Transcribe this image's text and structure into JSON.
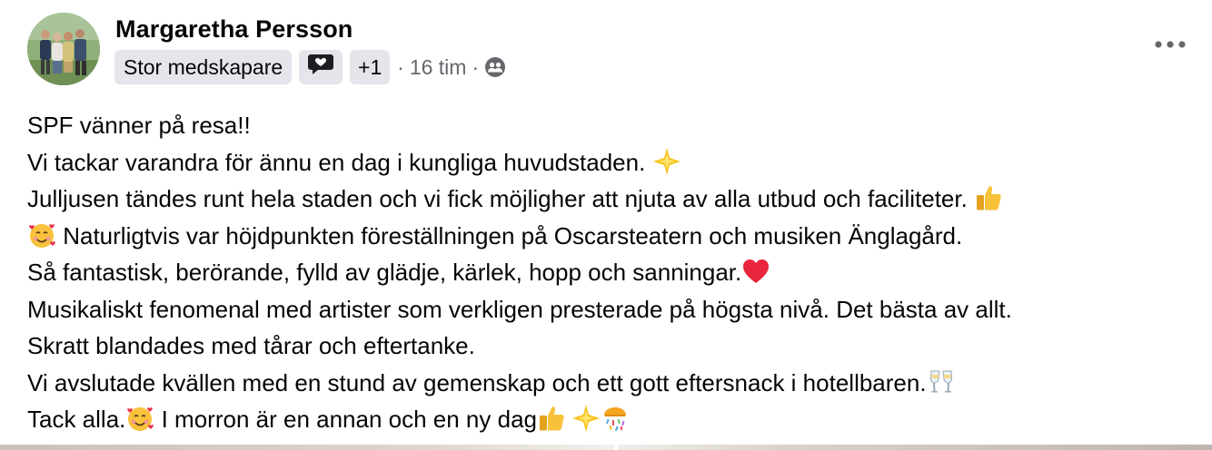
{
  "post": {
    "author_name": "Margaretha Persson",
    "badge_label": "Stor medskapare",
    "badge_icon": "speech-bubble-heart-icon",
    "badge_more": "+1",
    "meta_separator": "·",
    "time": "16 tim",
    "audience_icon": "friends-icon",
    "more_icon": "more-options-icon",
    "lines": [
      {
        "text": "SPF vänner på resa!!"
      },
      {
        "text": "Vi tackar varandra för ännu en dag i kungliga huvudstaden. ",
        "emoji_after": [
          "sparkle-star"
        ]
      },
      {
        "text": "Julljusen tändes runt hela staden och vi fick möjligher att njuta av alla utbud och faciliteter. ",
        "emoji_after": [
          "thumbs-up"
        ]
      },
      {
        "emoji_before": [
          "smiling-face-with-hearts"
        ],
        "text": " Naturligtvis var höjdpunkten föreställningen på Oscarsteatern och musiken Änglagård."
      },
      {
        "text": "Så fantastisk, berörande, fylld av glädje, kärlek,  hopp och sanningar.",
        "emoji_after": [
          "red-heart"
        ]
      },
      {
        "text": "Musikaliskt fenomenal med artister som verkligen presterade på högsta nivå. Det bästa av allt."
      },
      {
        "text": "Skratt blandades med tårar och eftertanke."
      },
      {
        "text": "Vi avslutade kvällen med en stund av gemenskap och ett gott eftersnack i hotellbaren.",
        "emoji_after": [
          "clinking-glasses"
        ]
      },
      {
        "text": "Tack alla.",
        "emoji_after": [
          "smiling-face-with-hearts"
        ],
        "text2": " I morron är en annan och en ny dag",
        "emoji_end": [
          "thumbs-up",
          "sparkle-star",
          "confetti-ball"
        ]
      }
    ]
  }
}
